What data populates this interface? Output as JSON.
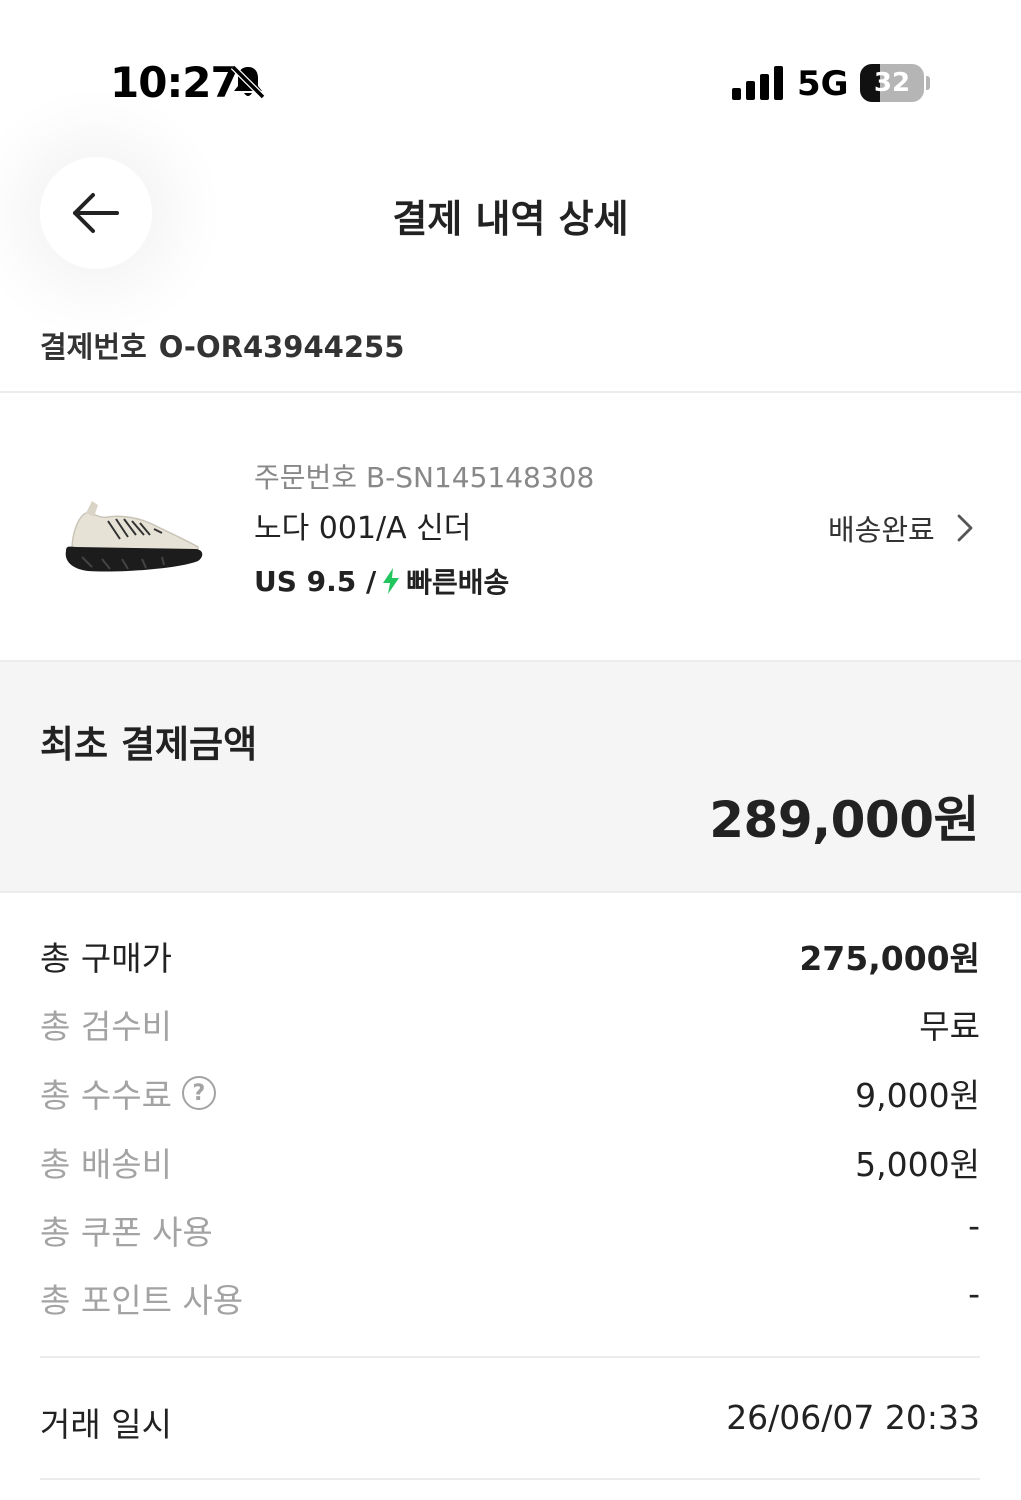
{
  "status_bar": {
    "time": "10:27",
    "network": "5G",
    "battery_level": "32",
    "battery_percent": 32
  },
  "header": {
    "title": "결제 내역 상세",
    "back_icon": "arrow-left-icon"
  },
  "payment": {
    "label": "결제번호",
    "number": "O-OR43944255"
  },
  "order": {
    "order_label": "주문번호",
    "order_number": "B-SN145148308",
    "product_name": "노다 001/A 신더",
    "size": "US 9.5 /",
    "delivery_type": "빠른배송",
    "status": "배송완료",
    "bolt_color": "#22c55e"
  },
  "total": {
    "label": "최초 결제금액",
    "amount": "289,000원"
  },
  "breakdown": {
    "purchase": {
      "label": "총 구매가",
      "value": "275,000원"
    },
    "inspection": {
      "label": "총 검수비",
      "value": "무료"
    },
    "fee": {
      "label": "총 수수료",
      "value": "9,000원",
      "help": "?"
    },
    "shipping": {
      "label": "총 배송비",
      "value": "5,000원"
    },
    "coupon": {
      "label": "총 쿠폰 사용",
      "value": "-"
    },
    "points": {
      "label": "총 포인트 사용",
      "value": "-"
    }
  },
  "transaction": {
    "label": "거래 일시",
    "datetime": "26/06/07 20:33"
  }
}
